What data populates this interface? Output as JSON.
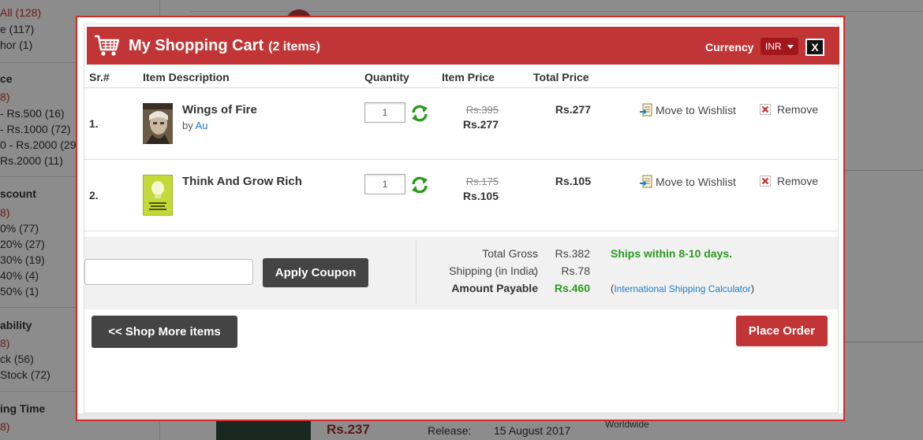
{
  "background": {
    "sidebar": [
      {
        "text": "All (128)",
        "style": "red"
      },
      {
        "text": "e (117)",
        "style": ""
      },
      {
        "text": "hor (1)",
        "style": ""
      },
      {
        "text": "ce",
        "style": "head"
      },
      {
        "text": "8)",
        "style": "red"
      },
      {
        "text": "- Rs.500 (16)",
        "style": ""
      },
      {
        "text": "- Rs.1000 (72)",
        "style": ""
      },
      {
        "text": "0 - Rs.2000 (29)",
        "style": ""
      },
      {
        "text": "Rs.2000 (11)",
        "style": ""
      },
      {
        "text": "scount",
        "style": "head"
      },
      {
        "text": "8)",
        "style": "red"
      },
      {
        "text": "0% (77)",
        "style": ""
      },
      {
        "text": "20% (27)",
        "style": ""
      },
      {
        "text": "30% (19)",
        "style": ""
      },
      {
        "text": "40% (4)",
        "style": ""
      },
      {
        "text": "50% (1)",
        "style": ""
      },
      {
        "text": "ability",
        "style": "head"
      },
      {
        "text": "8)",
        "style": "red"
      },
      {
        "text": "ck (56)",
        "style": ""
      },
      {
        "text": "Stock (72)",
        "style": ""
      },
      {
        "text": "ing Time",
        "style": "head"
      },
      {
        "text": "8)",
        "style": "red"
      }
    ],
    "price": "Rs.237",
    "release_label": "Release:",
    "release_value": "15 August 2017",
    "shipping_note": "Worldwide"
  },
  "cart": {
    "title": "My Shopping Cart",
    "count": "(2 items)",
    "currency_label": "Currency",
    "currency_value": "INR",
    "close_label": "X",
    "columns": {
      "sr": "Sr.#",
      "description": "Item Description",
      "quantity": "Quantity",
      "item_price": "Item Price",
      "total_price": "Total Price"
    },
    "items": [
      {
        "sr": "1.",
        "title": "Wings of Fire",
        "by_label": "by",
        "author": "Au",
        "quantity": "1",
        "old_price": "Rs.395",
        "new_price": "Rs.277",
        "total": "Rs.277",
        "wishlist_label": "Move to Wishlist",
        "remove_label": "Remove"
      },
      {
        "sr": "2.",
        "title": "Think And Grow Rich",
        "by_label": "",
        "author": "",
        "quantity": "1",
        "old_price": "Rs.175",
        "new_price": "Rs.105",
        "total": "Rs.105",
        "wishlist_label": "Move to Wishlist",
        "remove_label": "Remove"
      }
    ],
    "coupon": {
      "placeholder": "",
      "apply_label": "Apply Coupon"
    },
    "summary": {
      "gross_label": "Total Gross",
      "gross_value": "Rs.382",
      "shipping_label": "Shipping (in India)",
      "shipping_value": "Rs.78",
      "payable_label": "Amount Payable",
      "payable_value": "Rs.460",
      "colon": ":",
      "ships_note": "Ships within 8-10 days.",
      "intl_open": "(",
      "intl_link": "International Shipping Calculator",
      "intl_close": ")"
    },
    "shop_more_label": "<< Shop More items",
    "place_order_label": "Place Order"
  },
  "colors": {
    "brand_red": "#c23536",
    "dark_button": "#444444",
    "success_green": "#2a9a1e",
    "link_blue": "#1a7fc4"
  }
}
